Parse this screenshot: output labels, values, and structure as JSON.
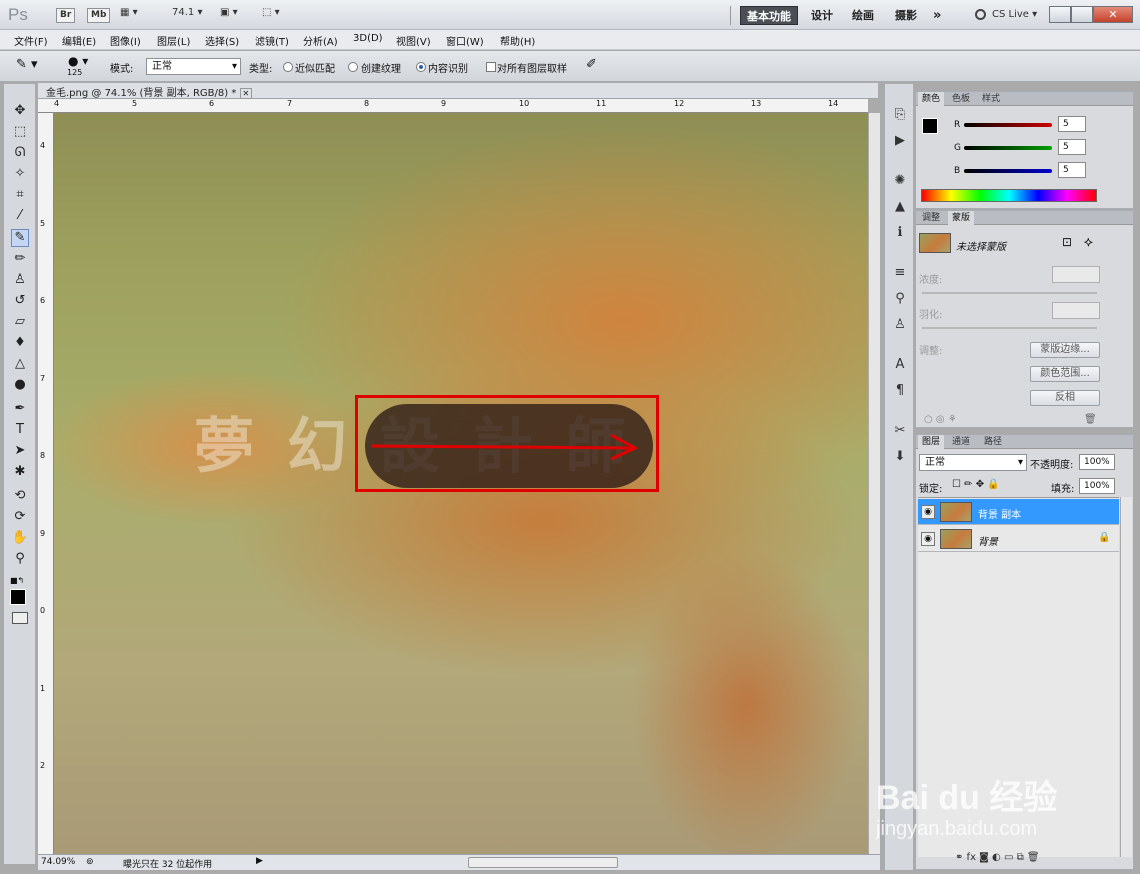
{
  "appbar": {
    "logo": "Ps",
    "br": "Br",
    "mb": "Mb",
    "zoom": "74.1",
    "workspaces": [
      "基本功能",
      "设计",
      "绘画",
      "摄影"
    ],
    "more": "»",
    "cslive": "CS Live"
  },
  "menu": [
    "文件(F)",
    "编辑(E)",
    "图像(I)",
    "图层(L)",
    "选择(S)",
    "滤镜(T)",
    "分析(A)",
    "3D(D)",
    "视图(V)",
    "窗口(W)",
    "帮助(H)"
  ],
  "options": {
    "brush_size": "125",
    "mode_label": "模式:",
    "mode_value": "正常",
    "type_label": "类型:",
    "type_options": [
      "近似匹配",
      "创建纹理",
      "内容识别"
    ],
    "type_selected": "内容识别",
    "sample_all_label": "对所有图层取样"
  },
  "document": {
    "tab_title": "金毛.png @ 74.1% (背景 副本, RGB/8) *",
    "watermark_text": "夢 幻 設 計 師",
    "ruler_top": [
      "4",
      "5",
      "6",
      "7",
      "8",
      "9",
      "10",
      "11",
      "12",
      "13",
      "14"
    ],
    "ruler_left": [
      "4",
      "5",
      "6",
      "7",
      "8",
      "9",
      "0",
      "1",
      "2"
    ],
    "zoom_status": "74.09%",
    "status_text": "曝光只在 32 位起作用"
  },
  "color_panel": {
    "tabs": [
      "颜色",
      "色板",
      "样式"
    ],
    "channels": [
      {
        "label": "R",
        "value": "5",
        "color": "#d00000"
      },
      {
        "label": "G",
        "value": "5",
        "color": "#00a000"
      },
      {
        "label": "B",
        "value": "5",
        "color": "#0000d0"
      }
    ]
  },
  "masks_panel": {
    "tabs": [
      "调整",
      "蒙版"
    ],
    "title": "未选择蒙版",
    "density_label": "浓度:",
    "feather_label": "羽化:",
    "refine_label": "调整:",
    "buttons": [
      "蒙版边缘...",
      "颜色范围...",
      "反相"
    ]
  },
  "layers_panel": {
    "tabs": [
      "图层",
      "通道",
      "路径"
    ],
    "blend_mode": "正常",
    "opacity_label": "不透明度:",
    "opacity_value": "100%",
    "lock_label": "锁定:",
    "fill_label": "填充:",
    "fill_value": "100%",
    "layers": [
      {
        "name": "背景 副本",
        "selected": true
      },
      {
        "name": "背景",
        "selected": false
      }
    ]
  },
  "watermark": {
    "brand": "Bai du 经验",
    "url": "jingyan.baidu.com"
  },
  "colors": {
    "highlight": "#e00000",
    "layer_selected": "#3399ff"
  }
}
